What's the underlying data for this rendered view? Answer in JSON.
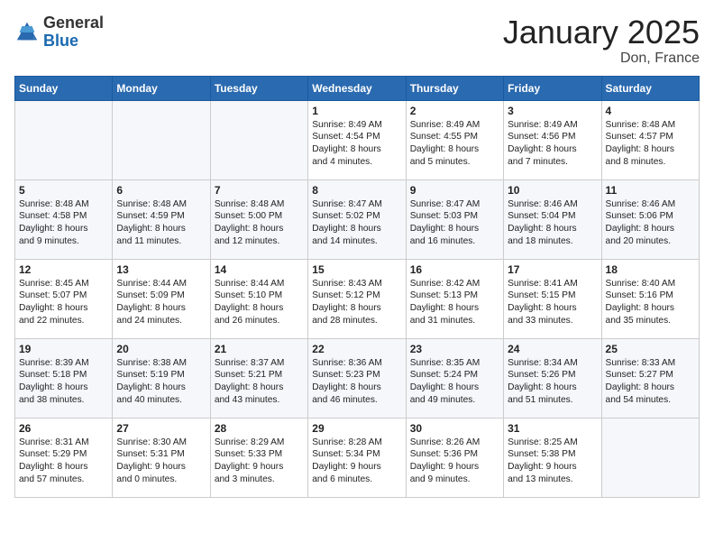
{
  "logo": {
    "general": "General",
    "blue": "Blue"
  },
  "header": {
    "month": "January 2025",
    "location": "Don, France"
  },
  "days_of_week": [
    "Sunday",
    "Monday",
    "Tuesday",
    "Wednesday",
    "Thursday",
    "Friday",
    "Saturday"
  ],
  "weeks": [
    [
      {
        "day": "",
        "info": ""
      },
      {
        "day": "",
        "info": ""
      },
      {
        "day": "",
        "info": ""
      },
      {
        "day": "1",
        "info": "Sunrise: 8:49 AM\nSunset: 4:54 PM\nDaylight: 8 hours\nand 4 minutes."
      },
      {
        "day": "2",
        "info": "Sunrise: 8:49 AM\nSunset: 4:55 PM\nDaylight: 8 hours\nand 5 minutes."
      },
      {
        "day": "3",
        "info": "Sunrise: 8:49 AM\nSunset: 4:56 PM\nDaylight: 8 hours\nand 7 minutes."
      },
      {
        "day": "4",
        "info": "Sunrise: 8:48 AM\nSunset: 4:57 PM\nDaylight: 8 hours\nand 8 minutes."
      }
    ],
    [
      {
        "day": "5",
        "info": "Sunrise: 8:48 AM\nSunset: 4:58 PM\nDaylight: 8 hours\nand 9 minutes."
      },
      {
        "day": "6",
        "info": "Sunrise: 8:48 AM\nSunset: 4:59 PM\nDaylight: 8 hours\nand 11 minutes."
      },
      {
        "day": "7",
        "info": "Sunrise: 8:48 AM\nSunset: 5:00 PM\nDaylight: 8 hours\nand 12 minutes."
      },
      {
        "day": "8",
        "info": "Sunrise: 8:47 AM\nSunset: 5:02 PM\nDaylight: 8 hours\nand 14 minutes."
      },
      {
        "day": "9",
        "info": "Sunrise: 8:47 AM\nSunset: 5:03 PM\nDaylight: 8 hours\nand 16 minutes."
      },
      {
        "day": "10",
        "info": "Sunrise: 8:46 AM\nSunset: 5:04 PM\nDaylight: 8 hours\nand 18 minutes."
      },
      {
        "day": "11",
        "info": "Sunrise: 8:46 AM\nSunset: 5:06 PM\nDaylight: 8 hours\nand 20 minutes."
      }
    ],
    [
      {
        "day": "12",
        "info": "Sunrise: 8:45 AM\nSunset: 5:07 PM\nDaylight: 8 hours\nand 22 minutes."
      },
      {
        "day": "13",
        "info": "Sunrise: 8:44 AM\nSunset: 5:09 PM\nDaylight: 8 hours\nand 24 minutes."
      },
      {
        "day": "14",
        "info": "Sunrise: 8:44 AM\nSunset: 5:10 PM\nDaylight: 8 hours\nand 26 minutes."
      },
      {
        "day": "15",
        "info": "Sunrise: 8:43 AM\nSunset: 5:12 PM\nDaylight: 8 hours\nand 28 minutes."
      },
      {
        "day": "16",
        "info": "Sunrise: 8:42 AM\nSunset: 5:13 PM\nDaylight: 8 hours\nand 31 minutes."
      },
      {
        "day": "17",
        "info": "Sunrise: 8:41 AM\nSunset: 5:15 PM\nDaylight: 8 hours\nand 33 minutes."
      },
      {
        "day": "18",
        "info": "Sunrise: 8:40 AM\nSunset: 5:16 PM\nDaylight: 8 hours\nand 35 minutes."
      }
    ],
    [
      {
        "day": "19",
        "info": "Sunrise: 8:39 AM\nSunset: 5:18 PM\nDaylight: 8 hours\nand 38 minutes."
      },
      {
        "day": "20",
        "info": "Sunrise: 8:38 AM\nSunset: 5:19 PM\nDaylight: 8 hours\nand 40 minutes."
      },
      {
        "day": "21",
        "info": "Sunrise: 8:37 AM\nSunset: 5:21 PM\nDaylight: 8 hours\nand 43 minutes."
      },
      {
        "day": "22",
        "info": "Sunrise: 8:36 AM\nSunset: 5:23 PM\nDaylight: 8 hours\nand 46 minutes."
      },
      {
        "day": "23",
        "info": "Sunrise: 8:35 AM\nSunset: 5:24 PM\nDaylight: 8 hours\nand 49 minutes."
      },
      {
        "day": "24",
        "info": "Sunrise: 8:34 AM\nSunset: 5:26 PM\nDaylight: 8 hours\nand 51 minutes."
      },
      {
        "day": "25",
        "info": "Sunrise: 8:33 AM\nSunset: 5:27 PM\nDaylight: 8 hours\nand 54 minutes."
      }
    ],
    [
      {
        "day": "26",
        "info": "Sunrise: 8:31 AM\nSunset: 5:29 PM\nDaylight: 8 hours\nand 57 minutes."
      },
      {
        "day": "27",
        "info": "Sunrise: 8:30 AM\nSunset: 5:31 PM\nDaylight: 9 hours\nand 0 minutes."
      },
      {
        "day": "28",
        "info": "Sunrise: 8:29 AM\nSunset: 5:33 PM\nDaylight: 9 hours\nand 3 minutes."
      },
      {
        "day": "29",
        "info": "Sunrise: 8:28 AM\nSunset: 5:34 PM\nDaylight: 9 hours\nand 6 minutes."
      },
      {
        "day": "30",
        "info": "Sunrise: 8:26 AM\nSunset: 5:36 PM\nDaylight: 9 hours\nand 9 minutes."
      },
      {
        "day": "31",
        "info": "Sunrise: 8:25 AM\nSunset: 5:38 PM\nDaylight: 9 hours\nand 13 minutes."
      },
      {
        "day": "",
        "info": ""
      }
    ]
  ]
}
